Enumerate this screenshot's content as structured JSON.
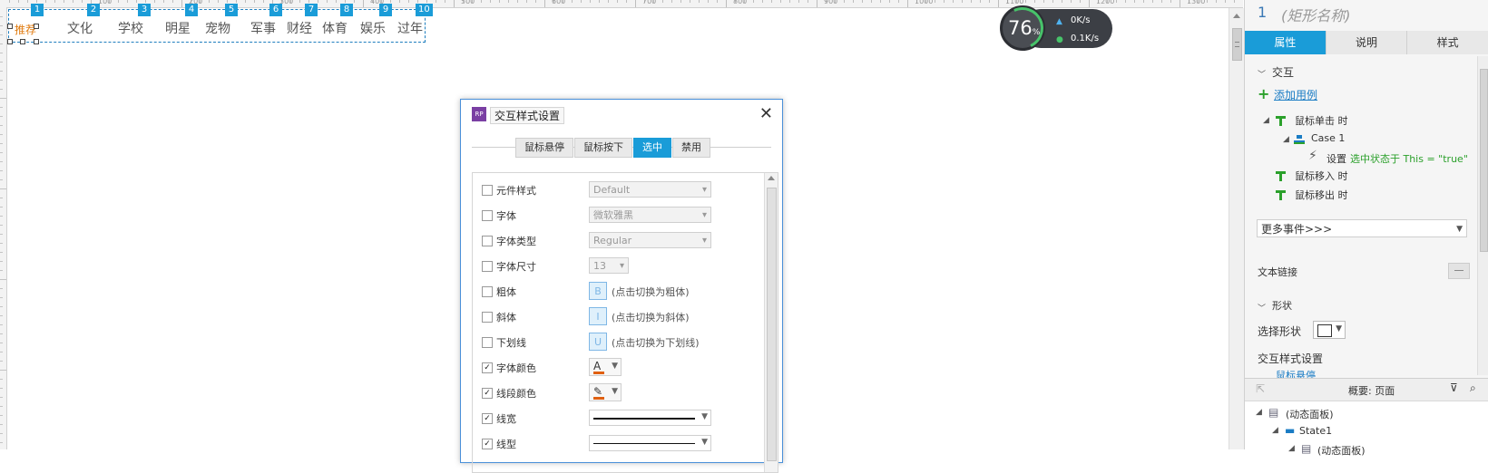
{
  "ruler": {
    "labels": [
      "100",
      "200",
      "300",
      "400",
      "500",
      "600",
      "700",
      "800",
      "900",
      "1000",
      "1100",
      "1200",
      "1300"
    ]
  },
  "nav": {
    "items": [
      {
        "badge": "1",
        "label": "推荐",
        "active": true
      },
      {
        "badge": "2",
        "label": "文化"
      },
      {
        "badge": "3",
        "label": "学校"
      },
      {
        "badge": "4",
        "label": "明星"
      },
      {
        "badge": "5",
        "label": "宠物"
      },
      {
        "badge": "6",
        "label": "军事"
      },
      {
        "badge": "7",
        "label": "财经"
      },
      {
        "badge": "8",
        "label": "体育"
      },
      {
        "badge": "9",
        "label": "娱乐"
      },
      {
        "badge": "10",
        "label": "过年"
      }
    ]
  },
  "speed": {
    "percent": "76",
    "percent_unit": "%",
    "up": "0K/s",
    "down": "0.1K/s"
  },
  "dialog": {
    "icon_text": "RP",
    "title": "交互样式设置",
    "close": "✕",
    "tabs": [
      {
        "label": "鼠标悬停"
      },
      {
        "label": "鼠标按下"
      },
      {
        "label": "选中",
        "active": true
      },
      {
        "label": "禁用"
      }
    ],
    "rows": [
      {
        "label": "元件样式",
        "checked": false,
        "value": "Default"
      },
      {
        "label": "字体",
        "checked": false,
        "value": "微软雅黑"
      },
      {
        "label": "字体类型",
        "checked": false,
        "value": "Regular"
      },
      {
        "label": "字体尺寸",
        "checked": false,
        "value": "13"
      },
      {
        "label": "粗体",
        "checked": false,
        "btn": "B",
        "hint": "(点击切换为粗体)"
      },
      {
        "label": "斜体",
        "checked": false,
        "btn": "I",
        "hint": "(点击切换为斜体)"
      },
      {
        "label": "下划线",
        "checked": false,
        "btn": "U",
        "hint": "(点击切换为下划线)"
      },
      {
        "label": "字体颜色",
        "checked": true,
        "glyph": "A"
      },
      {
        "label": "线段颜色",
        "checked": true,
        "glyph": "✎"
      },
      {
        "label": "线宽",
        "checked": true
      },
      {
        "label": "线型",
        "checked": true
      }
    ],
    "check_mark": "✓"
  },
  "panel": {
    "number": "1",
    "name": "(矩形名称)",
    "tabs": [
      {
        "label": "属性",
        "active": true
      },
      {
        "label": "说明"
      },
      {
        "label": "样式"
      }
    ],
    "section_interaction": "交互",
    "add_case": "添加用例",
    "add_icon": "+",
    "on_click": "鼠标单击 时",
    "case1": "Case 1",
    "action_prefix": "设置",
    "action_text": "选中状态于 This = \"true\"",
    "on_enter": "鼠标移入 时",
    "on_leave": "鼠标移出 时",
    "more_events": "更多事件>>>",
    "text_link": "文本链接",
    "section_shape": "形状",
    "select_shape": "选择形状",
    "interaction_style": "交互样式设置",
    "hover_item": "鼠标悬停",
    "outline_title": "概要: 页面",
    "tree_dynamic": "(动态面板)",
    "tree_state": "State1",
    "tree_sub": "(动态面板)"
  }
}
